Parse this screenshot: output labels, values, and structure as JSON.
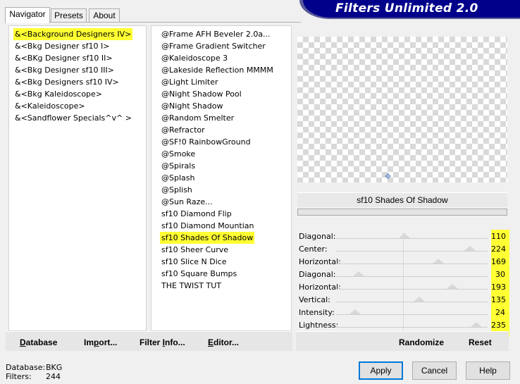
{
  "tabs": [
    "Navigator",
    "Presets",
    "About"
  ],
  "banner": "Filters Unlimited 2.0",
  "categories": [
    "&<Background Designers IV>",
    "&<Bkg Designer sf10 I>",
    "&<BKg Designer sf10 II>",
    "&<Bkg Designer sf10 III>",
    "&<Bkg Designers sf10 IV>",
    "&<Bkg Kaleidoscope>",
    "&<Kaleidoscope>",
    "&<Sandflower Specials^v^ >"
  ],
  "selected_category_index": 0,
  "filters": [
    "@Frame AFH Beveler 2.0a...",
    "@Frame Gradient Switcher",
    "@Kaleidoscope 3",
    "@Lakeside Reflection MMMM",
    "@Light Limiter",
    "@Night Shadow Pool",
    "@Night Shadow",
    "@Random Smelter",
    "@Refractor",
    "@SF!0 RainbowGround",
    "@Smoke",
    "@Spirals",
    "@Splash",
    "@Splish",
    "@Sun Raze...",
    "sf10 Diamond Flip",
    "sf10 Diamond Mountian",
    "sf10 Shades Of Shadow",
    "sf10 Sheer Curve",
    "sf10 Slice N Dice",
    "sf10 Square Bumps",
    "THE TWIST TUT"
  ],
  "selected_filter_index": 17,
  "current_filter_name": "sf10 Shades Of Shadow",
  "parameters": [
    {
      "label": "Diagonal:",
      "value": "110"
    },
    {
      "label": "Center:",
      "value": "224"
    },
    {
      "label": "Horizontal:",
      "value": "169"
    },
    {
      "label": "Diagonal:",
      "value": "30"
    },
    {
      "label": "Horizontal:",
      "value": "193"
    },
    {
      "label": "Vertical:",
      "value": "135"
    },
    {
      "label": "Intensity:",
      "value": "24"
    },
    {
      "label": "Lightness:",
      "value": "235"
    }
  ],
  "slider_max": 255,
  "left_buttons": {
    "database": {
      "u": "D",
      "rest": "atabase"
    },
    "import": {
      "pre": "Im",
      "u": "p",
      "rest": "ort..."
    },
    "filter_info": {
      "pre": "Filter ",
      "u": "I",
      "rest": "nfo..."
    },
    "editor": {
      "u": "E",
      "rest": "ditor..."
    }
  },
  "randomize_label": "Randomize",
  "reset_label": "Reset",
  "status": {
    "database_label": "Database:",
    "database_value": "BKG",
    "filters_label": "Filters:",
    "filters_value": "244"
  },
  "buttons": {
    "apply": "Apply",
    "cancel": "Cancel",
    "help": "Help"
  },
  "colors": {
    "highlight": "#ffff33",
    "banner": "#00008b"
  }
}
